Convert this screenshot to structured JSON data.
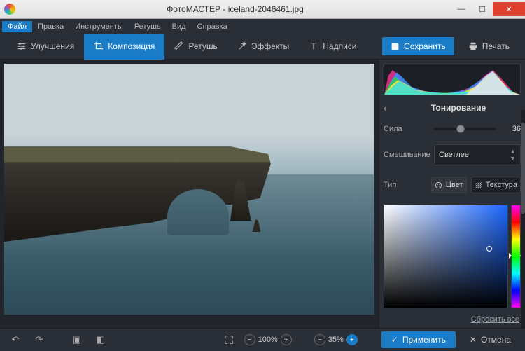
{
  "window": {
    "title": "ФотоМАСТЕР - iceland-2046461.jpg"
  },
  "menu": {
    "items": [
      "Файл",
      "Правка",
      "Инструменты",
      "Ретушь",
      "Вид",
      "Справка"
    ],
    "activeIndex": 0
  },
  "toolbar": {
    "tabs": [
      {
        "icon": "sliders",
        "label": "Улучшения"
      },
      {
        "icon": "crop",
        "label": "Композиция"
      },
      {
        "icon": "brush",
        "label": "Ретушь"
      },
      {
        "icon": "wand",
        "label": "Эффекты"
      },
      {
        "icon": "text",
        "label": "Надписи"
      }
    ],
    "activeIndex": 1,
    "save": "Сохранить",
    "print": "Печать"
  },
  "panel": {
    "title": "Тонирование",
    "strength": {
      "label": "Сила",
      "value": 36,
      "min": 0,
      "max": 100
    },
    "blend": {
      "label": "Смешивание",
      "value": "Светлее"
    },
    "type": {
      "label": "Тип",
      "options": [
        {
          "icon": "palette",
          "label": "Цвет",
          "active": true
        },
        {
          "icon": "hatch",
          "label": "Текстура",
          "active": false
        }
      ]
    },
    "reset": "Сбросить все"
  },
  "status": {
    "zoom": "100%",
    "opacity": "35%",
    "apply": "Применить",
    "cancel": "Отмена"
  }
}
